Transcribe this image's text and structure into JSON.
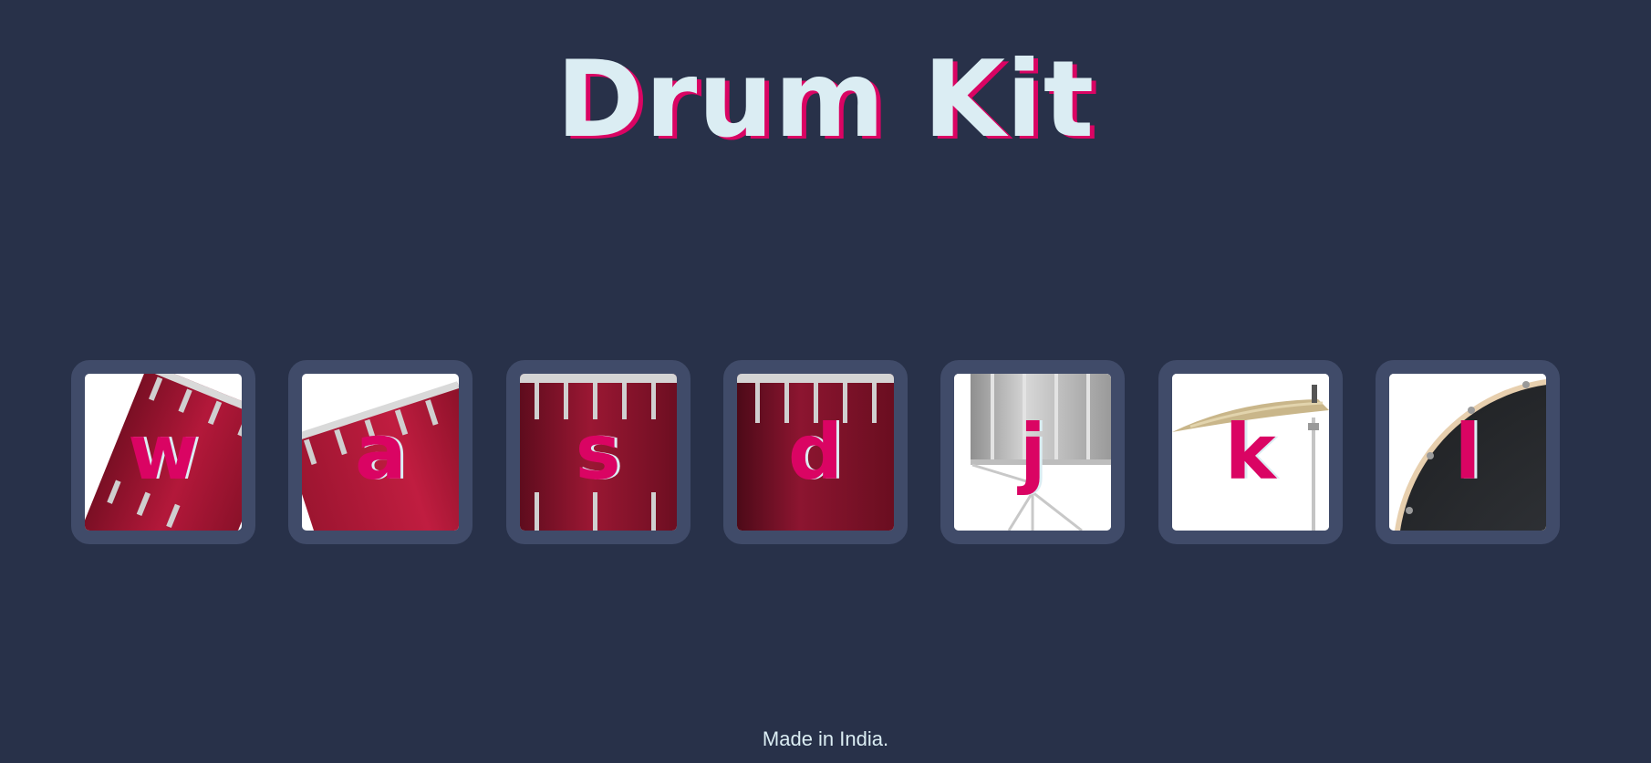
{
  "title": "Drum Kit",
  "colors": {
    "background": "#283149",
    "title_text": "#DBEDF3",
    "accent": "#DA0463",
    "tile_border": "#404B69"
  },
  "drums": [
    {
      "key": "w",
      "instrument": "tom-icon"
    },
    {
      "key": "a",
      "instrument": "tom-icon"
    },
    {
      "key": "s",
      "instrument": "tom-icon"
    },
    {
      "key": "d",
      "instrument": "tom-icon"
    },
    {
      "key": "j",
      "instrument": "snare-icon"
    },
    {
      "key": "k",
      "instrument": "crash-cymbal-icon"
    },
    {
      "key": "l",
      "instrument": "kick-drum-icon"
    }
  ],
  "footer": "Made in India."
}
